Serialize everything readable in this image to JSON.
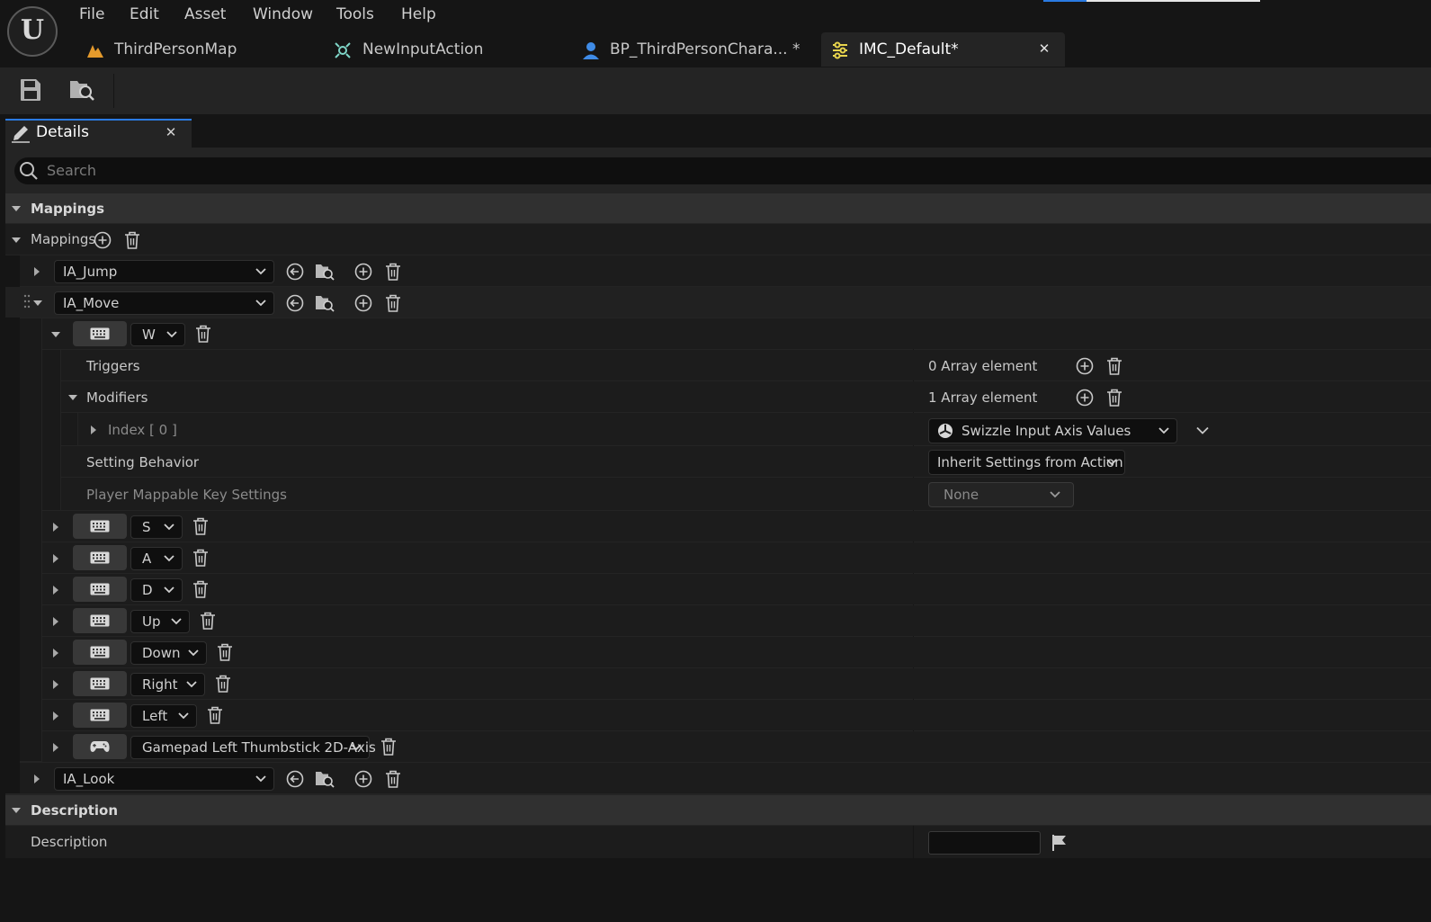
{
  "menu": [
    "File",
    "Edit",
    "Asset",
    "Window",
    "Tools",
    "Help"
  ],
  "tabs": {
    "map": "ThirdPersonMap",
    "action": "NewInputAction",
    "character": "BP_ThirdPersonChara... *",
    "imc": "IMC_Default*"
  },
  "details": {
    "title": "Details",
    "search_placeholder": "Search"
  },
  "mappings_category": "Mappings",
  "mappings_array_label": "Mappings",
  "actions": {
    "jump": "IA_Jump",
    "move": "IA_Move",
    "look": "IA_Look"
  },
  "w_mapping": {
    "key": "W",
    "triggers_label": "Triggers",
    "triggers_value": "0 Array element",
    "modifiers_label": "Modifiers",
    "modifiers_value": "1 Array element",
    "index_label": "Index [ 0 ]",
    "modifier_value": "Swizzle Input Axis Values",
    "setting_behavior_label": "Setting Behavior",
    "setting_behavior_value": "Inherit Settings from Action",
    "player_mappable_label": "Player Mappable Key Settings",
    "player_mappable_value": "None"
  },
  "keys": [
    "S",
    "A",
    "D",
    "Up",
    "Down",
    "Right",
    "Left",
    "Gamepad Left Thumbstick 2D-Axis"
  ],
  "description_category": "Description",
  "description_label": "Description",
  "colors": {
    "accent": "#2a7ae2",
    "panel": "#242424",
    "background": "#151515"
  }
}
